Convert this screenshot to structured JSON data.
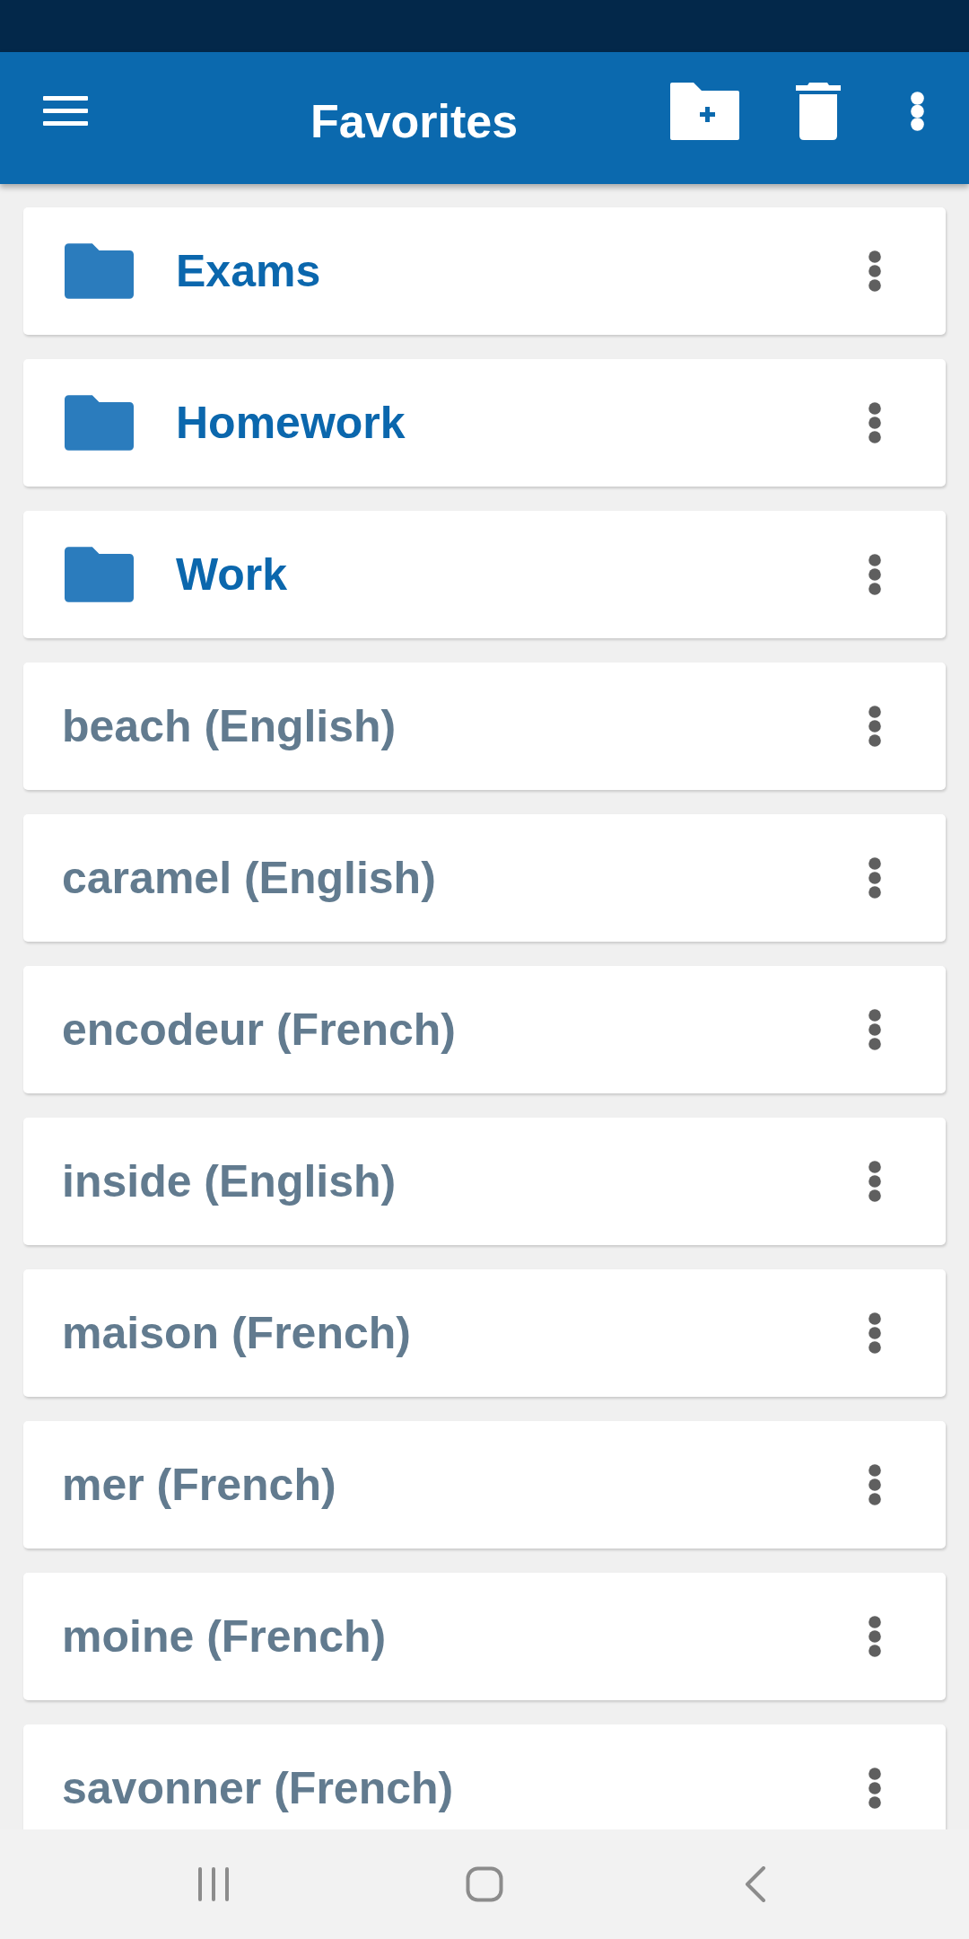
{
  "app_bar": {
    "title": "Favorites"
  },
  "items": [
    {
      "kind": "folder",
      "label": "Exams"
    },
    {
      "kind": "folder",
      "label": "Homework"
    },
    {
      "kind": "folder",
      "label": "Work"
    },
    {
      "kind": "word",
      "label": "beach (English)"
    },
    {
      "kind": "word",
      "label": "caramel (English)"
    },
    {
      "kind": "word",
      "label": "encodeur (French)"
    },
    {
      "kind": "word",
      "label": "inside (English)"
    },
    {
      "kind": "word",
      "label": "maison (French)"
    },
    {
      "kind": "word",
      "label": "mer (French)"
    },
    {
      "kind": "word",
      "label": "moine (French)"
    },
    {
      "kind": "word",
      "label": "savonner (French)"
    }
  ]
}
